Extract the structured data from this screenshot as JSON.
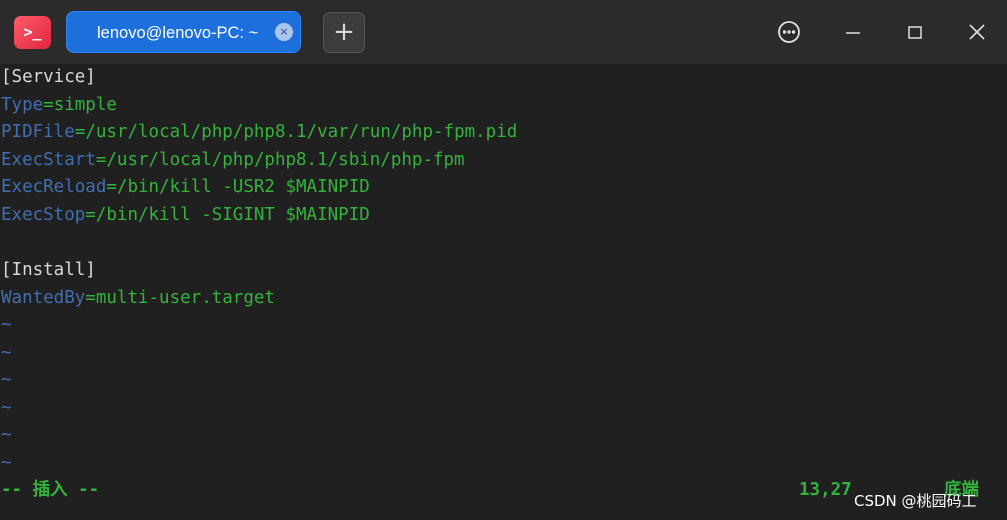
{
  "window": {
    "tab_title": "lenovo@lenovo-PC: ~",
    "app_icon_glyph": ">_",
    "new_tab_glyph": "+",
    "tab_close_glyph": "×"
  },
  "editor": {
    "lines": [
      {
        "kind": "section",
        "text": "[Service]"
      },
      {
        "kind": "kv",
        "key": "Type",
        "value": "simple"
      },
      {
        "kind": "kv",
        "key": "PIDFile",
        "value": "/usr/local/php/php8.1/var/run/php-fpm.pid"
      },
      {
        "kind": "kv",
        "key": "ExecStart",
        "value": "/usr/local/php/php8.1/sbin/php-fpm"
      },
      {
        "kind": "kv",
        "key": "ExecReload",
        "value": "/bin/kill -USR2 $MAINPID"
      },
      {
        "kind": "kv",
        "key": "ExecStop",
        "value": "/bin/kill -SIGINT $MAINPID"
      },
      {
        "kind": "blank",
        "text": ""
      },
      {
        "kind": "section",
        "text": "[Install]"
      },
      {
        "kind": "kv",
        "key": "WantedBy",
        "value": "multi-user.target"
      },
      {
        "kind": "tilde",
        "text": "~"
      },
      {
        "kind": "tilde",
        "text": "~"
      },
      {
        "kind": "tilde",
        "text": "~"
      },
      {
        "kind": "tilde",
        "text": "~"
      },
      {
        "kind": "tilde",
        "text": "~"
      },
      {
        "kind": "tilde",
        "text": "~"
      }
    ],
    "separator": "=",
    "mode": "-- 插入 --",
    "cursor_pos": "13,27",
    "scroll_pos": "底端"
  },
  "watermark": "CSDN @桃园码工",
  "colors": {
    "section": "#d8d8d8",
    "key": "#3f6fb3",
    "value": "#34b33c",
    "tab_active": "#1d6fdc"
  },
  "icons": [
    "terminal-app-icon",
    "more-options-icon",
    "minimize-icon",
    "maximize-icon",
    "close-icon",
    "plus-icon"
  ]
}
